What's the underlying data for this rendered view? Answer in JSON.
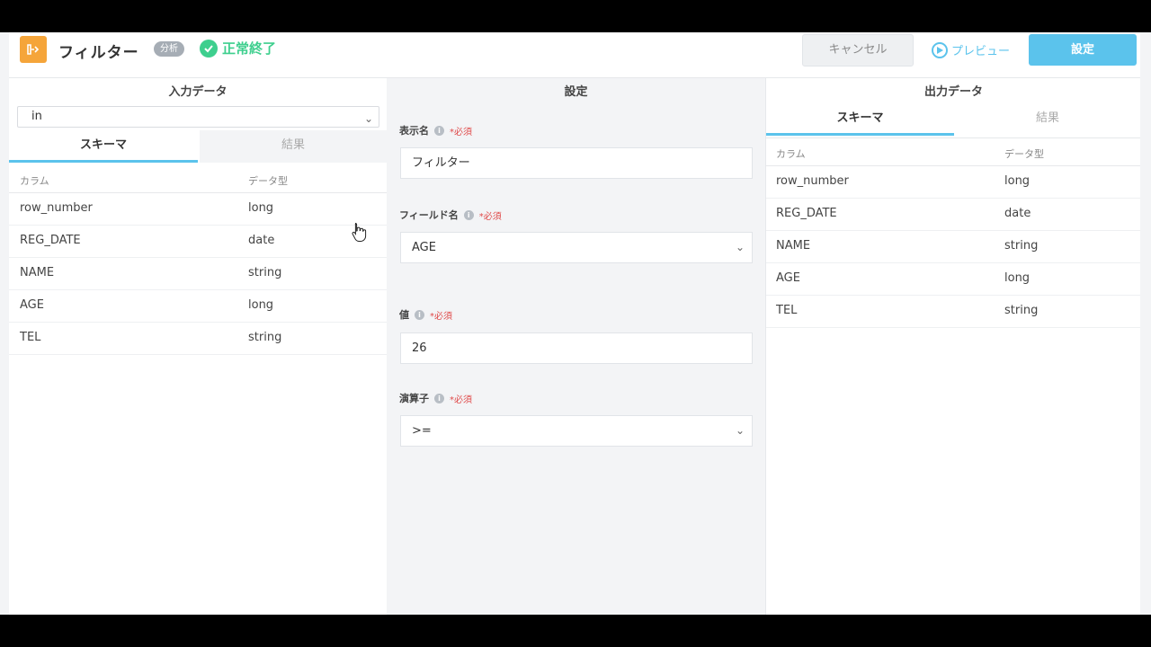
{
  "header": {
    "title": "フィルター",
    "badge": "分析",
    "status": "正常終了",
    "cancel_label": "キャンセル",
    "preview_label": "プレビュー",
    "set_label": "設定"
  },
  "left_panel": {
    "title": "入力データ",
    "select_value": "in",
    "tabs": [
      "スキーマ",
      "結果"
    ],
    "columns": [
      "カラム",
      "データ型"
    ],
    "rows": [
      {
        "column": "row_number",
        "type": "long"
      },
      {
        "column": "REG_DATE",
        "type": "date"
      },
      {
        "column": "NAME",
        "type": "string"
      },
      {
        "column": "AGE",
        "type": "long"
      },
      {
        "column": "TEL",
        "type": "string"
      }
    ]
  },
  "middle_panel": {
    "title": "設定",
    "required_mark": "*必須",
    "fields": [
      {
        "label": "表示名",
        "value": "フィルター"
      },
      {
        "label": "フィールド名",
        "value": "AGE"
      },
      {
        "label": "値",
        "value": "26"
      },
      {
        "label": "演算子",
        "value": ">="
      }
    ]
  },
  "right_panel": {
    "title": "出力データ",
    "tabs": [
      "スキーマ",
      "結果"
    ],
    "columns": [
      "カラム",
      "データ型"
    ],
    "rows": [
      {
        "column": "row_number",
        "type": "long"
      },
      {
        "column": "REG_DATE",
        "type": "date"
      },
      {
        "column": "NAME",
        "type": "string"
      },
      {
        "column": "AGE",
        "type": "long"
      },
      {
        "column": "TEL",
        "type": "string"
      }
    ]
  },
  "colors": {
    "accent": "#5bc3ec",
    "success": "#3ecf8e",
    "logo": "#f5a53a",
    "required": "#e04b4b"
  }
}
